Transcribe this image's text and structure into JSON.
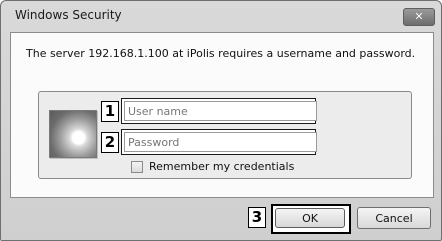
{
  "window": {
    "title": "Windows Security",
    "close_glyph": "✕"
  },
  "message": "The server 192.168.1.100 at iPolis requires a username and password.",
  "markers": [
    "1",
    "2",
    "3"
  ],
  "fields": {
    "username": {
      "placeholder": "User name",
      "value": ""
    },
    "password": {
      "placeholder": "Password",
      "value": ""
    }
  },
  "remember": {
    "label": "Remember my credentials",
    "checked": false
  },
  "buttons": {
    "ok": "OK",
    "cancel": "Cancel"
  },
  "icons": {
    "user_tile": "user-tile-icon",
    "close": "close-icon"
  },
  "colors": {
    "frame": "#d9d9d9",
    "content_bg": "#fbfbfb",
    "panel_bg": "#ececec"
  }
}
